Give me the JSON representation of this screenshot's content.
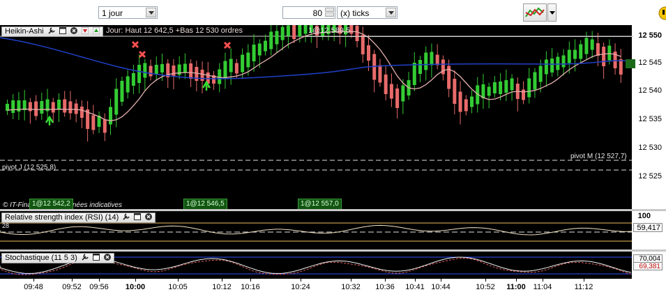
{
  "toolbar": {
    "period_value": "1 jour",
    "ticks_value": "80",
    "ticks_unit": "(x) ticks"
  },
  "main_panel": {
    "title": "Heikin-Ashi",
    "header_info": "Jour: Haut 12 642,5  +Bas 12 530 ordres",
    "orders_tag": "1@12 589,5",
    "pivot_m": "pivot M (12 527,7)",
    "pivot_j": "pivot J (12 525,8)",
    "source": "© IT-Finance.com Données indicatives",
    "tags": [
      "1@12 542,2",
      "1@12 546,5",
      "1@12 557,0"
    ],
    "y_ticks": [
      "12 550",
      "12 545",
      "12 540",
      "12 535",
      "12 530",
      "12 525"
    ],
    "price_label": "12 545"
  },
  "rsi_panel": {
    "title": "Relative strength index (RSI) (14)",
    "level_100": "100",
    "level_label": "28",
    "value": "59,417"
  },
  "stoch_panel": {
    "title": "Stochastique (11 5 3)",
    "value_1": "70,004",
    "value_2": "69,381"
  },
  "x_axis": [
    "09:48",
    "09:52",
    "09:56",
    "10:00",
    "10:05",
    "10:12",
    "10:16",
    "10:24",
    "10:32",
    "10:36",
    "10:41",
    "10:44",
    "10:52",
    "11:00",
    "11:04",
    "11:12"
  ],
  "colors": {
    "bull": "#33cc33",
    "bear": "#e86a6a",
    "ma_fast": "#e6b0b0",
    "ma_slow": "#2040c8",
    "rsi": "#f0e0c0",
    "stoch": "#e06060"
  }
}
